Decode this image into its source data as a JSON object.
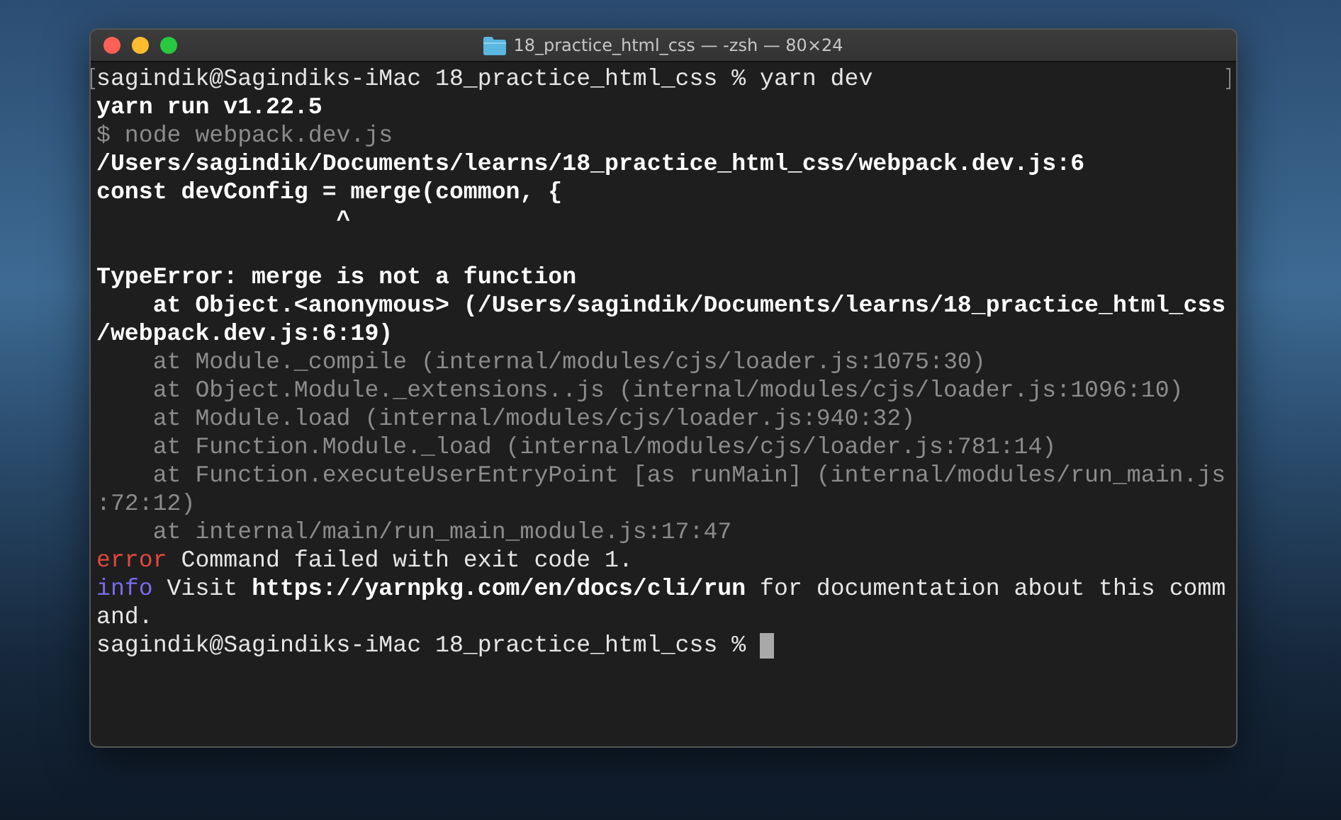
{
  "window": {
    "title": "18_practice_html_css — -zsh — 80×24"
  },
  "terminal": {
    "lines": [
      {
        "segments": [
          {
            "kind": "plain",
            "text": "sagindik@Sagindiks-iMac 18_practice_html_css % yarn dev"
          }
        ]
      },
      {
        "segments": [
          {
            "kind": "bold",
            "text": "yarn run v1.22.5"
          }
        ]
      },
      {
        "segments": [
          {
            "kind": "dim",
            "text": "$ node webpack.dev.js"
          }
        ]
      },
      {
        "segments": [
          {
            "kind": "bold",
            "text": "/Users/sagindik/Documents/learns/18_practice_html_css/webpack.dev.js:6"
          }
        ]
      },
      {
        "segments": [
          {
            "kind": "bold",
            "text": "const devConfig = merge(common, {"
          }
        ]
      },
      {
        "segments": [
          {
            "kind": "bold",
            "text": "                 ^"
          }
        ]
      },
      {
        "blank_before": true,
        "segments": [
          {
            "kind": "bold",
            "text": "TypeError: merge is not a function"
          }
        ]
      },
      {
        "segments": [
          {
            "kind": "bold",
            "text": "    at Object.<anonymous> (/Users/sagindik/Documents/learns/18_practice_html_css"
          }
        ]
      },
      {
        "segments": [
          {
            "kind": "bold",
            "text": "/webpack.dev.js:6:19)"
          }
        ]
      },
      {
        "segments": [
          {
            "kind": "dim",
            "text": "    at Module._compile (internal/modules/cjs/loader.js:1075:30)"
          }
        ]
      },
      {
        "segments": [
          {
            "kind": "dim",
            "text": "    at Object.Module._extensions..js (internal/modules/cjs/loader.js:1096:10)"
          }
        ]
      },
      {
        "segments": [
          {
            "kind": "dim",
            "text": "    at Module.load (internal/modules/cjs/loader.js:940:32)"
          }
        ]
      },
      {
        "segments": [
          {
            "kind": "dim",
            "text": "    at Function.Module._load (internal/modules/cjs/loader.js:781:14)"
          }
        ]
      },
      {
        "segments": [
          {
            "kind": "dim",
            "text": "    at Function.executeUserEntryPoint [as runMain] (internal/modules/run_main.js"
          }
        ]
      },
      {
        "segments": [
          {
            "kind": "dim",
            "text": ":72:12)"
          }
        ]
      },
      {
        "segments": [
          {
            "kind": "dim",
            "text": "    at internal/main/run_main_module.js:17:47"
          }
        ]
      },
      {
        "segments": [
          {
            "kind": "error",
            "text": "error"
          },
          {
            "kind": "plain",
            "text": " Command failed with exit code 1."
          }
        ]
      },
      {
        "segments": [
          {
            "kind": "info",
            "text": "info"
          },
          {
            "kind": "plain",
            "text": " Visit "
          },
          {
            "kind": "bold",
            "text": "https://yarnpkg.com/en/docs/cli/run"
          },
          {
            "kind": "plain",
            "text": " for documentation about this comm"
          }
        ]
      },
      {
        "segments": [
          {
            "kind": "plain",
            "text": "and."
          }
        ]
      },
      {
        "cursor": true,
        "segments": [
          {
            "kind": "plain",
            "text": "sagindik@Sagindiks-iMac 18_practice_html_css % "
          }
        ]
      }
    ]
  }
}
